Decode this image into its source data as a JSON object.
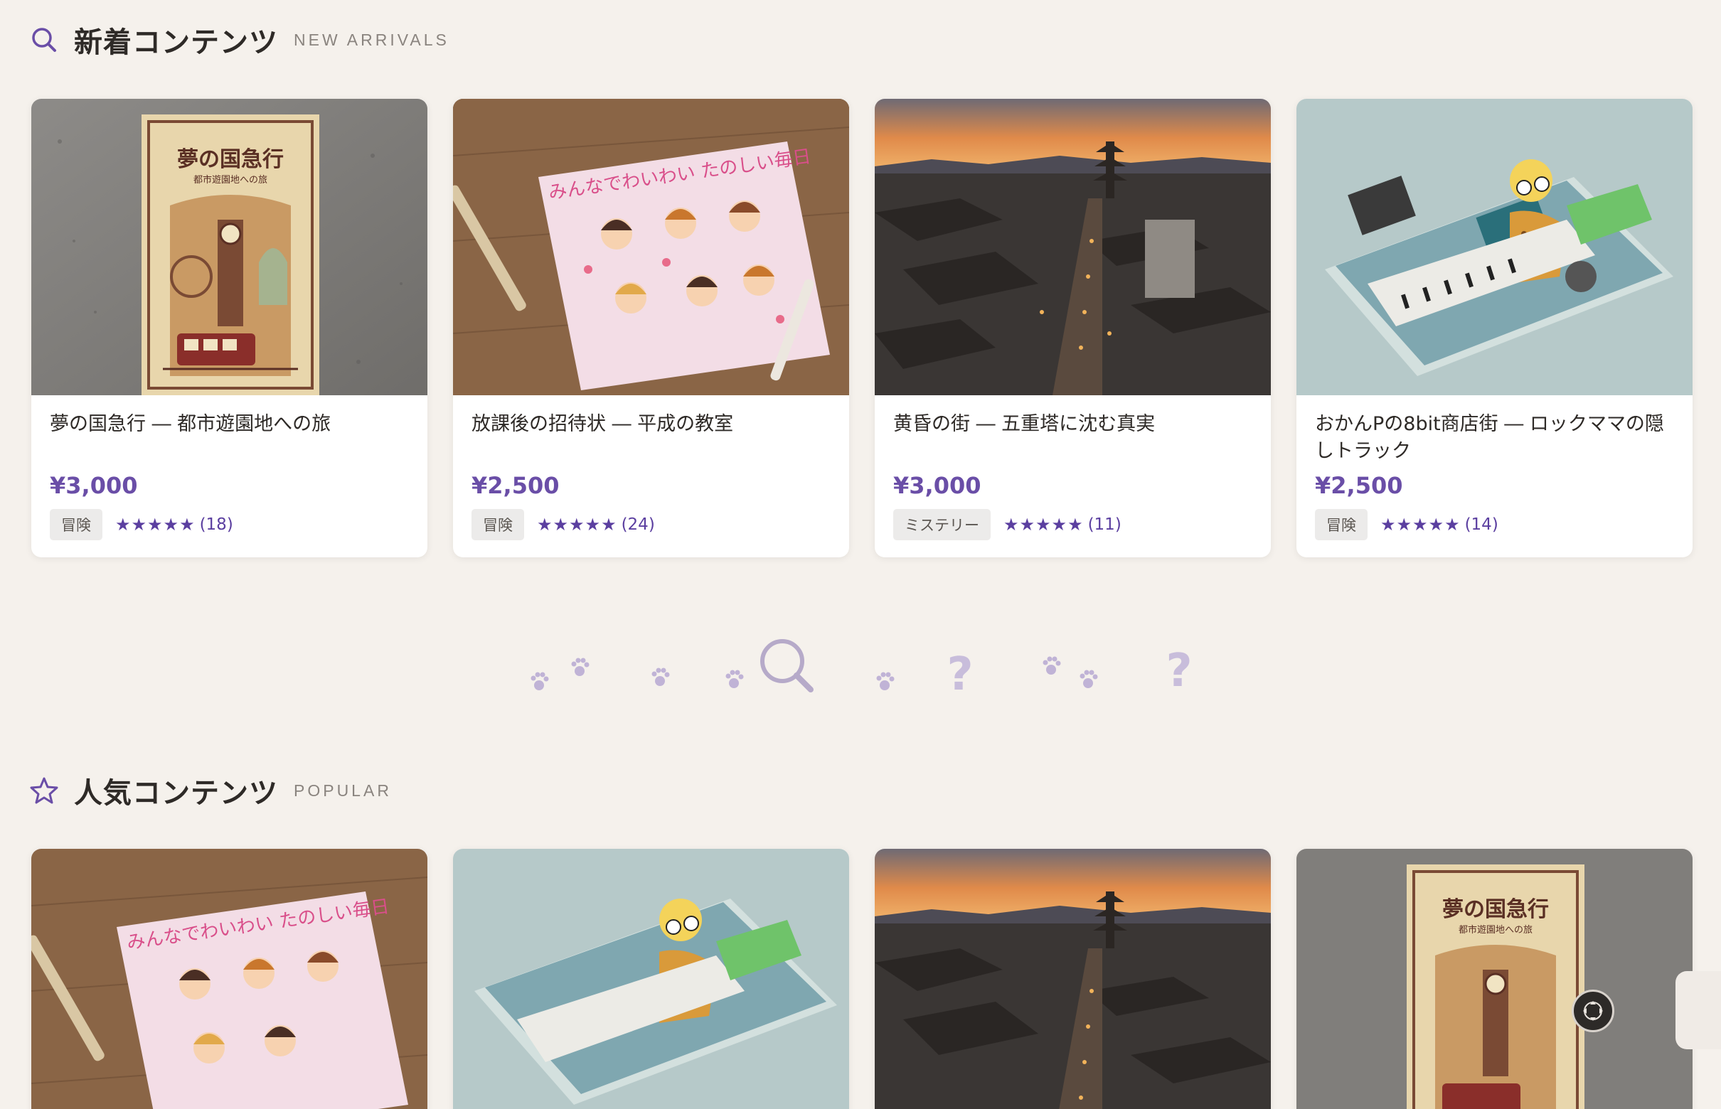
{
  "sections": {
    "new": {
      "title": "新着コンテンツ",
      "subtitle": "NEW ARRIVALS",
      "icon": "search-icon"
    },
    "popular": {
      "title": "人気コンテンツ",
      "subtitle": "POPULAR",
      "icon": "star-icon"
    }
  },
  "new_cards": [
    {
      "title": "夢の国急行 ― 都市遊園地への旅",
      "price": "¥3,000",
      "tag": "冒険",
      "stars": "★★★★★",
      "count": "(18)",
      "image": "retro-poster"
    },
    {
      "title": "放課後の招待状 ― 平成の教室",
      "price": "¥2,500",
      "tag": "冒険",
      "stars": "★★★★★",
      "count": "(24)",
      "image": "sticker-sheet"
    },
    {
      "title": "黄昏の街 ― 五重塔に沈む真実",
      "price": "¥3,000",
      "tag": "ミステリー",
      "stars": "★★★★★",
      "count": "(11)",
      "image": "kyoto-dusk"
    },
    {
      "title": "おかんPの8bit商店街 ― ロックママの隠しトラック",
      "price": "¥2,500",
      "tag": "冒険",
      "stars": "★★★★★",
      "count": "(14)",
      "image": "cd-case"
    }
  ],
  "popular_cards": [
    {
      "image": "sticker-sheet"
    },
    {
      "image": "cd-case"
    },
    {
      "image": "kyoto-dusk"
    },
    {
      "image": "retro-poster"
    }
  ],
  "poster_text": {
    "title": "夢の国急行",
    "subtitle": "都市遊園地への旅"
  },
  "sticker_text": "みんなでわいわい たのしい毎日",
  "colors": {
    "accent": "#6a4ea7",
    "background": "#f5f1ec"
  },
  "decor_icons": [
    "paw-icon",
    "magnifier-icon",
    "question-icon"
  ]
}
